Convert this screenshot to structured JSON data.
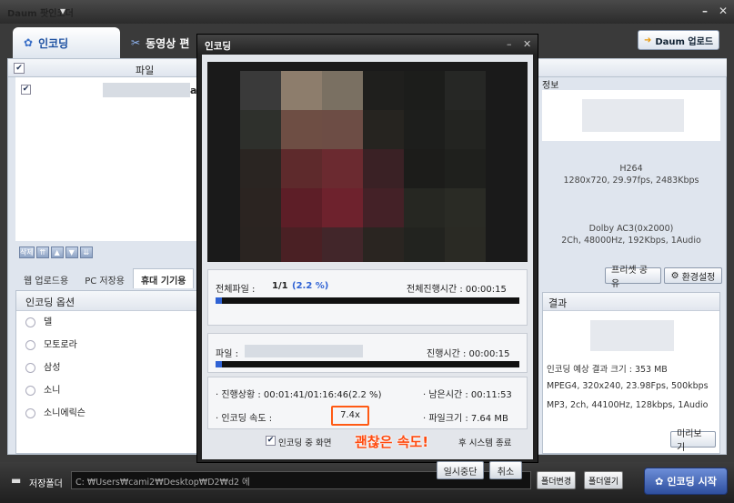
{
  "window": {
    "title": "Daum 팟인코더",
    "title_menu_icon": "chevron-down-icon"
  },
  "main_tabs": [
    {
      "label": "인코딩",
      "icon": "encode-icon"
    },
    {
      "label": "동영상 편",
      "icon": "movie-edit-icon"
    }
  ],
  "upload_button": {
    "label": "Daum 업로드"
  },
  "file_list": {
    "header": "파일",
    "rows": [
      {
        "name_visible": "avi",
        "checked": true
      }
    ]
  },
  "device_tabs": [
    "웹 업로드용",
    "PC 저장용",
    "휴대 기기용"
  ],
  "encoding_options": {
    "title": "인코딩 옵션",
    "items": [
      "델",
      "모토로라",
      "삼성",
      "소니",
      "소니에릭슨"
    ]
  },
  "source_info": {
    "header": "정보",
    "video": "H264",
    "video_detail": "1280x720, 29.97fps, 2483Kbps",
    "audio": "Dolby AC3(0x2000)",
    "audio_detail": "2Ch, 48000Hz, 192Kbps, 1Audio"
  },
  "preset_buttons": [
    "프리셋 공유",
    "환경설정"
  ],
  "result": {
    "header": "결과",
    "size": "인코딩 예상 결과 크기 : 353 MB",
    "video": "MPEG4, 320x240, 23.98Fps, 500kbps",
    "audio": "MP3, 2ch, 44100Hz, 128kbps, 1Audio",
    "preview_button": "미리보기"
  },
  "bottom": {
    "save_folder_label": "저장폴더",
    "path": "C: ₩Users₩cami2₩Desktop₩D2₩d2 에",
    "change_button": "폴더변경",
    "open_button": "폴더열기",
    "start_button": "인코딩 시작"
  },
  "dialog": {
    "title": "인코딩",
    "total_files_label": "전체파일 :",
    "total_files_value": "1/1",
    "total_percent": "(2.2 %)",
    "total_elapsed": "전체진행시간 : 00:00:15",
    "total_progress": 0.022,
    "file_label": "파일 :",
    "file_elapsed": "진행시간 : 00:00:15",
    "file_progress": 0.022,
    "status": "· 진행상황 : 00:01:41/01:16:46(2.2 %)",
    "remaining": "· 남은시간 : 00:11:53",
    "speed_label": "· 인코딩 속도 :",
    "speed_value": "7.4x",
    "file_size": "· 파일크기 : 7.64 MB",
    "shutdown_option_left": "인코딩 중 화면",
    "shutdown_option_right": "후 시스템 종료",
    "annotation": "괜찮은 속도!",
    "pause_button": "일시중단",
    "cancel_button": "취소"
  },
  "colors": {
    "accent": "#2f62d4",
    "highlight": "#ff5a14"
  }
}
